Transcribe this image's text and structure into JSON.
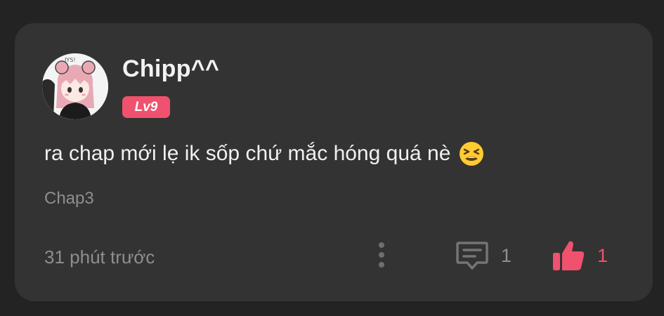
{
  "comment_card": {
    "username": "Chipp^^",
    "level": "Lv9",
    "text": "ra chap mới lẹ ik sốp chứ mắc hóng quá nè",
    "emoji": "tired-face-emoji",
    "chapter": "Chap3",
    "time": "31 phút trước",
    "reply_count": "1",
    "like_count": "1",
    "colors": {
      "background": "#232323",
      "card": "#333333",
      "accent": "#f0516e",
      "muted_text": "#8e8e8e"
    }
  }
}
